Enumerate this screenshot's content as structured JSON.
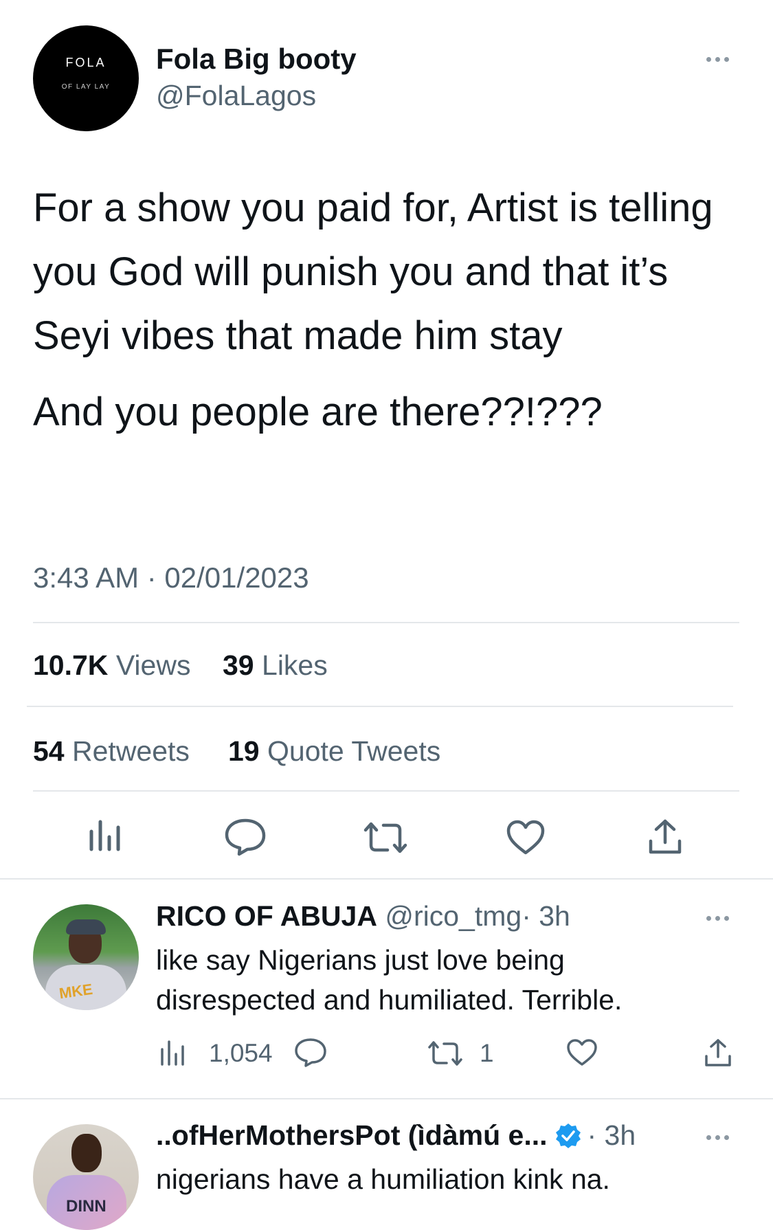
{
  "tweet": {
    "display_name": "Fola Big booty",
    "handle": "@FolaLagos",
    "avatar_text_top": "FOLA",
    "avatar_text_bottom": "OF LAY LAY",
    "text_p1": "For a show you paid for, Artist is telling you God will punish you and that it’s Seyi vibes that made him stay",
    "text_p2": "And you people are there??!???",
    "timestamp": "3:43 AM · 02/01/2023",
    "stats": {
      "views_count": "10.7K",
      "views_label": "Views",
      "likes_count": "39",
      "likes_label": "Likes",
      "retweets_count": "54",
      "retweets_label": "Retweets",
      "quotes_count": "19",
      "quotes_label": "Quote Tweets"
    }
  },
  "replies": [
    {
      "display_name": "RICO OF ABUJA",
      "handle": "@rico_tmg",
      "time": "· 3h",
      "text": "like say Nigerians just love being disrespected and humiliated. Terrible.",
      "views": "1,054",
      "retweets": "1",
      "avatar_shirt_text": "MKE"
    },
    {
      "display_name": "..ofHerMothersPot (ìdàmú e...",
      "handle": "",
      "time": "· 3h",
      "text": "nigerians have a humiliation kink na.",
      "verified": true,
      "avatar_shirt_text": "DINN"
    }
  ],
  "colors": {
    "text": "#0f1419",
    "muted": "#536471",
    "verified_blue": "#1d9bf0",
    "divider": "#e4e7ea"
  },
  "icons": [
    "more-icon",
    "views-icon",
    "reply-icon",
    "retweet-icon",
    "like-icon",
    "share-icon",
    "verified-icon"
  ]
}
